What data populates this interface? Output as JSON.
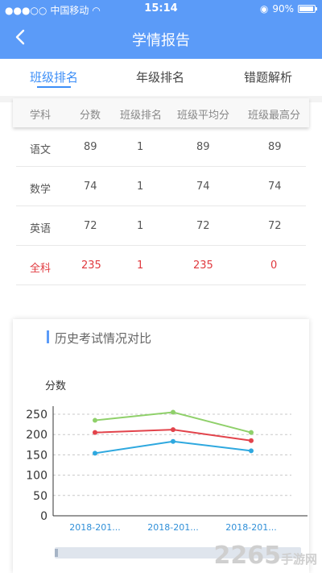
{
  "status_bar": {
    "carrier": "中国移动",
    "time": "15:14",
    "battery": "90%"
  },
  "nav": {
    "title": "学情报告",
    "back_icon": "chevron-left-icon"
  },
  "tabs": [
    {
      "label": "班级排名",
      "active": true
    },
    {
      "label": "年级排名",
      "active": false
    },
    {
      "label": "错题解析",
      "active": false
    }
  ],
  "table": {
    "headers": [
      "学科",
      "分数",
      "班级排名",
      "班级平均分",
      "班级最高分"
    ],
    "rows": [
      {
        "subject": "语文",
        "score": "89",
        "rank": "1",
        "avg": "89",
        "max": "89"
      },
      {
        "subject": "数学",
        "score": "74",
        "rank": "1",
        "avg": "74",
        "max": "74"
      },
      {
        "subject": "英语",
        "score": "72",
        "rank": "1",
        "avg": "72",
        "max": "72"
      },
      {
        "subject": "全科",
        "score": "235",
        "rank": "1",
        "avg": "235",
        "max": "0"
      }
    ]
  },
  "chart_card": {
    "title": "历史考试情况对比"
  },
  "chart_data": {
    "type": "line",
    "title": "",
    "ylabel": "分数",
    "xlabel": "",
    "ylim": [
      0,
      250
    ],
    "yticks": [
      "0",
      "50",
      "100",
      "150",
      "200",
      "250"
    ],
    "categories": [
      "2018-201...",
      "2018-201...",
      "2018-201..."
    ],
    "grid": true,
    "series": [
      {
        "color": "#8fd06a",
        "values": [
          235,
          255,
          205
        ]
      },
      {
        "color": "#e2434b",
        "values": [
          205,
          212,
          185
        ]
      },
      {
        "color": "#2ea8df",
        "values": [
          154,
          183,
          160
        ]
      }
    ]
  },
  "watermark": {
    "text": "2265",
    "sub": "手游网"
  }
}
